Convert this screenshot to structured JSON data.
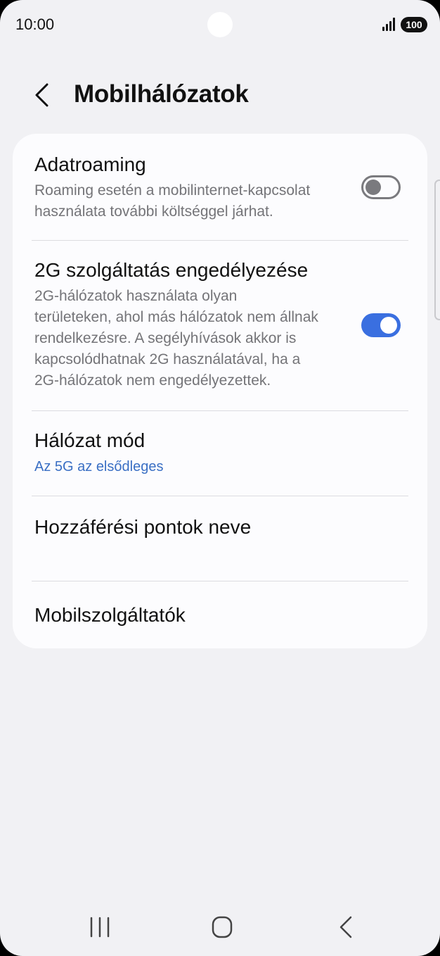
{
  "status": {
    "time": "10:00",
    "battery": "100"
  },
  "header": {
    "title": "Mobilhálózatok",
    "back_icon": "chevron-left-icon"
  },
  "settings": {
    "data_roaming": {
      "title": "Adatroaming",
      "description_line1": "Roaming esetén a mobilinternet-kapcsolat",
      "description_line2": "használata további költséggel járhat.",
      "enabled": false
    },
    "allow_2g": {
      "title": "2G szolgáltatás engedélyezése",
      "description_line1": "2G-hálózatok használata olyan",
      "description_line2": "területeken, ahol más hálózatok nem állnak",
      "description_line3": "rendelkezésre. A segélyhívások akkor is",
      "description_line4": "kapcsolódhatnak 2G használatával, ha a",
      "description_line5": "2G-hálózatok nem engedélyezettek.",
      "enabled": true
    },
    "network_mode": {
      "title": "Hálózat mód",
      "value": "Az 5G az elsődleges"
    },
    "apn": {
      "title": "Hozzáférési pontok neve"
    },
    "operators": {
      "title": "Mobilszolgáltatók"
    }
  },
  "colors": {
    "accent": "#3a6fe0",
    "link": "#3a6fc4",
    "background": "#f1f1f4",
    "card": "#fcfcfe"
  },
  "nav": {
    "recents_icon": "recents-icon",
    "home_icon": "home-icon",
    "back_icon": "back-icon"
  }
}
